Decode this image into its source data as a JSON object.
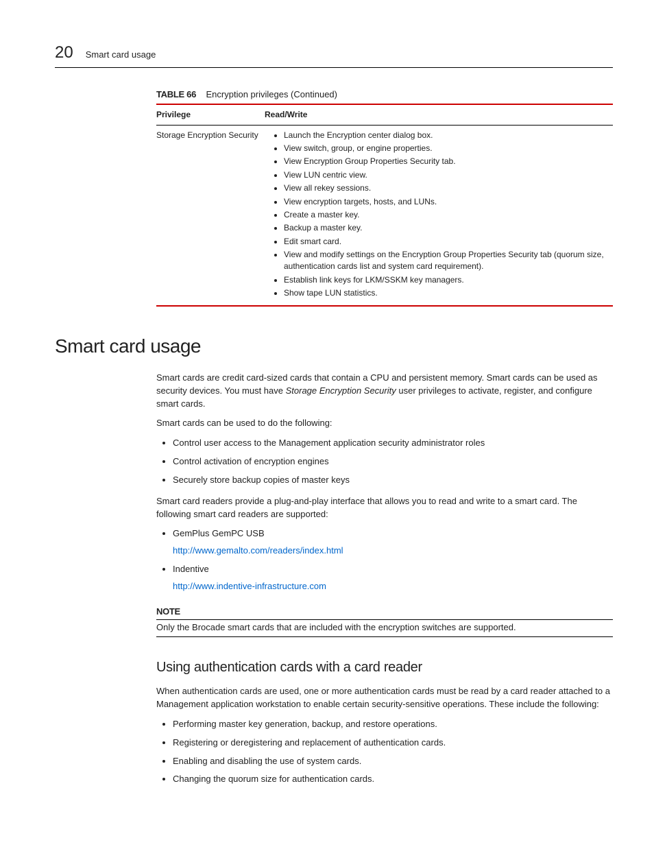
{
  "header": {
    "chapter_number": "20",
    "running_title": "Smart card usage"
  },
  "table": {
    "label": "TABLE 66",
    "caption": "Encryption privileges (Continued)",
    "headers": {
      "col1": "Privilege",
      "col2": "Read/Write"
    },
    "row": {
      "privilege": "Storage Encryption Security",
      "items": [
        "Launch the Encryption center dialog box.",
        "View switch, group, or engine properties.",
        "View Encryption Group Properties Security tab.",
        "View LUN centric view.",
        "View all rekey sessions.",
        "View encryption targets, hosts, and LUNs.",
        "Create a master key.",
        "Backup a master key.",
        "Edit smart card.",
        "View and modify settings on the Encryption Group Properties Security tab (quorum size, authentication cards list and system card requirement).",
        "Establish link keys for LKM/SSKM key managers.",
        "Show tape LUN statistics."
      ]
    }
  },
  "section": {
    "title": "Smart card usage",
    "para1_a": "Smart cards are credit card-sized cards that contain a CPU and persistent memory. Smart cards can be used as security devices. You must have ",
    "para1_italic": "Storage Encryption Security",
    "para1_b": " user privileges to activate, register, and configure smart cards.",
    "para2": "Smart cards can be used to do the following:",
    "uses": [
      "Control user access to the Management application security administrator roles",
      "Control activation of encryption engines",
      "Securely store backup copies of master keys"
    ],
    "para3": "Smart card readers provide a plug-and-play interface that allows you to read and write to a smart card. The following smart card readers are supported:",
    "readers": [
      {
        "name": "GemPlus GemPC USB",
        "url": "http://www.gemalto.com/readers/index.html"
      },
      {
        "name": "Indentive",
        "url": "http://www.indentive-infrastructure.com"
      }
    ],
    "note_label": "NOTE",
    "note_text": "Only the Brocade smart cards that are included with the encryption switches are supported."
  },
  "subsection": {
    "title": "Using authentication cards with a card reader",
    "para1": "When authentication cards are used, one or more authentication cards must be read by a card reader attached to a Management application workstation to enable certain security-sensitive operations. These include the following:",
    "items": [
      "Performing master key generation, backup, and restore operations.",
      "Registering or deregistering and replacement of authentication cards.",
      "Enabling and disabling the use of system cards.",
      "Changing the quorum size for authentication cards."
    ]
  }
}
